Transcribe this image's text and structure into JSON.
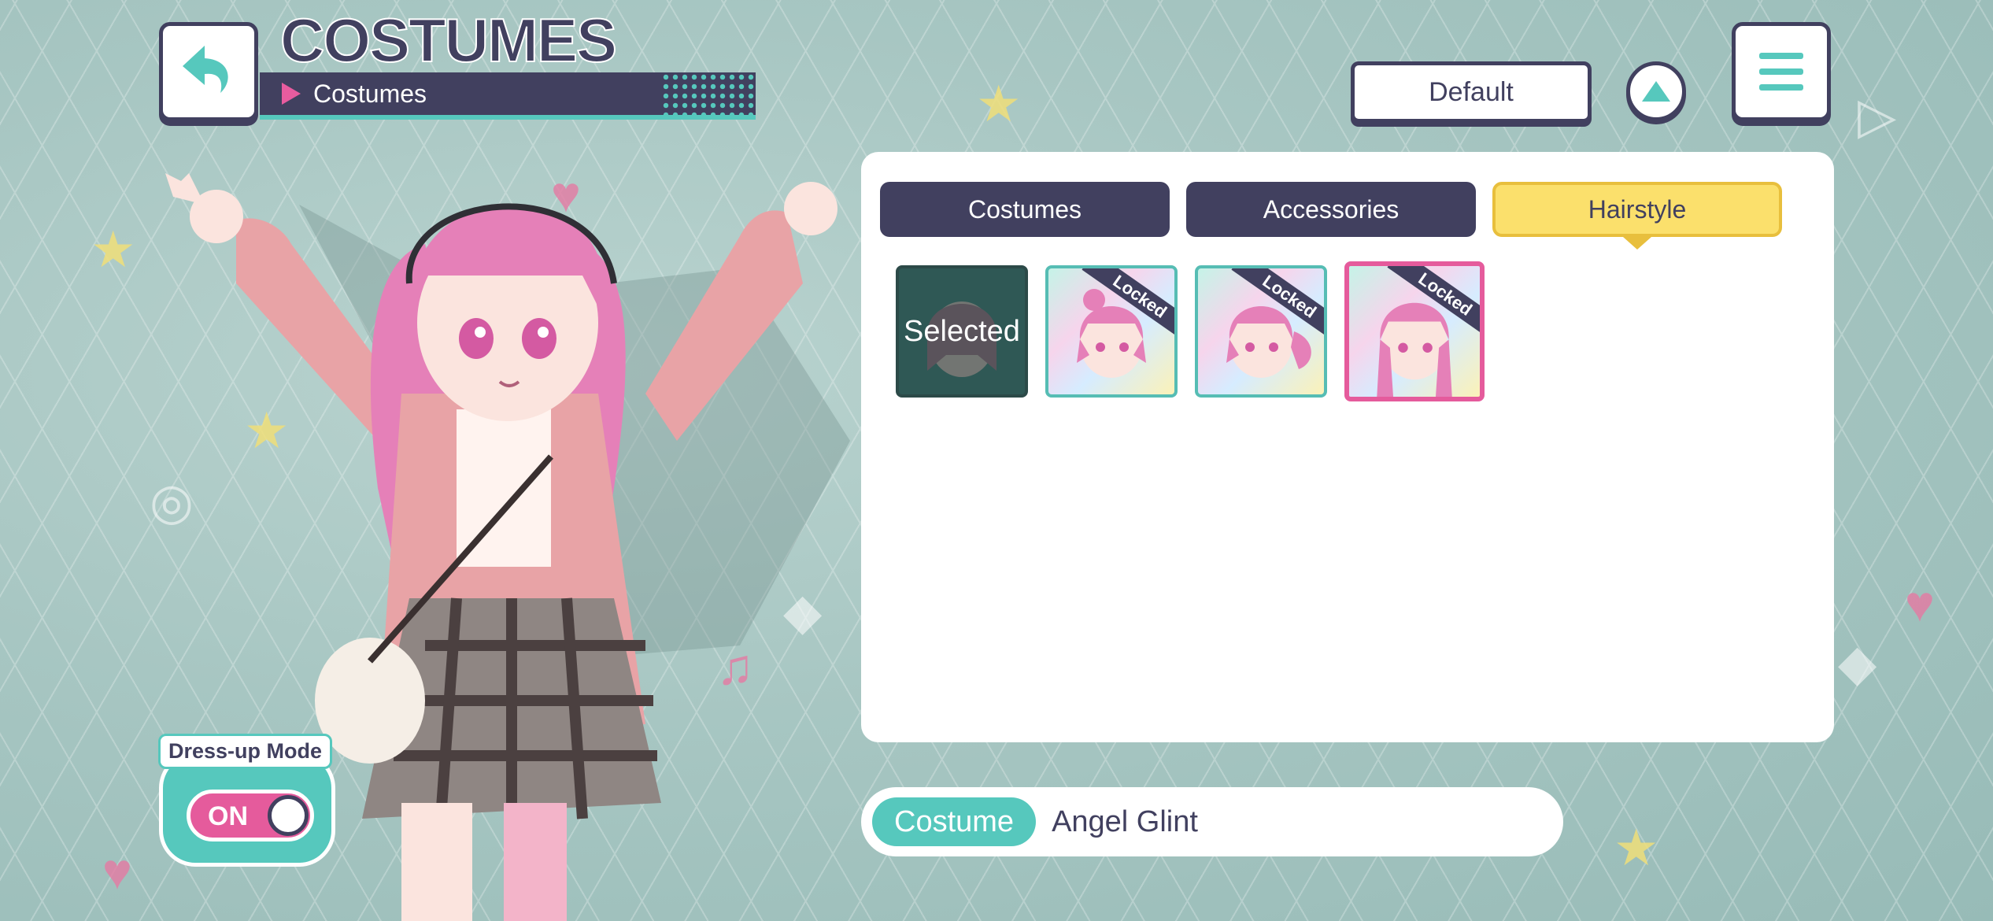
{
  "header": {
    "title": "COSTUMES",
    "subtitle": "Costumes",
    "sort_value": "Default"
  },
  "tabs": [
    {
      "label": "Costumes",
      "active": false
    },
    {
      "label": "Accessories",
      "active": false
    },
    {
      "label": "Hairstyle",
      "active": true
    }
  ],
  "hairstyles": [
    {
      "status": "Selected"
    },
    {
      "status": "Locked"
    },
    {
      "status": "Locked"
    },
    {
      "status": "Locked"
    }
  ],
  "dress_up": {
    "label": "Dress-up Mode",
    "state": "ON"
  },
  "costume_info": {
    "tag": "Costume",
    "name": "Angel Glint"
  },
  "colors": {
    "navy": "#41405f",
    "teal": "#56c8bd",
    "pink": "#e55b9c",
    "yellow": "#fbe06c"
  }
}
